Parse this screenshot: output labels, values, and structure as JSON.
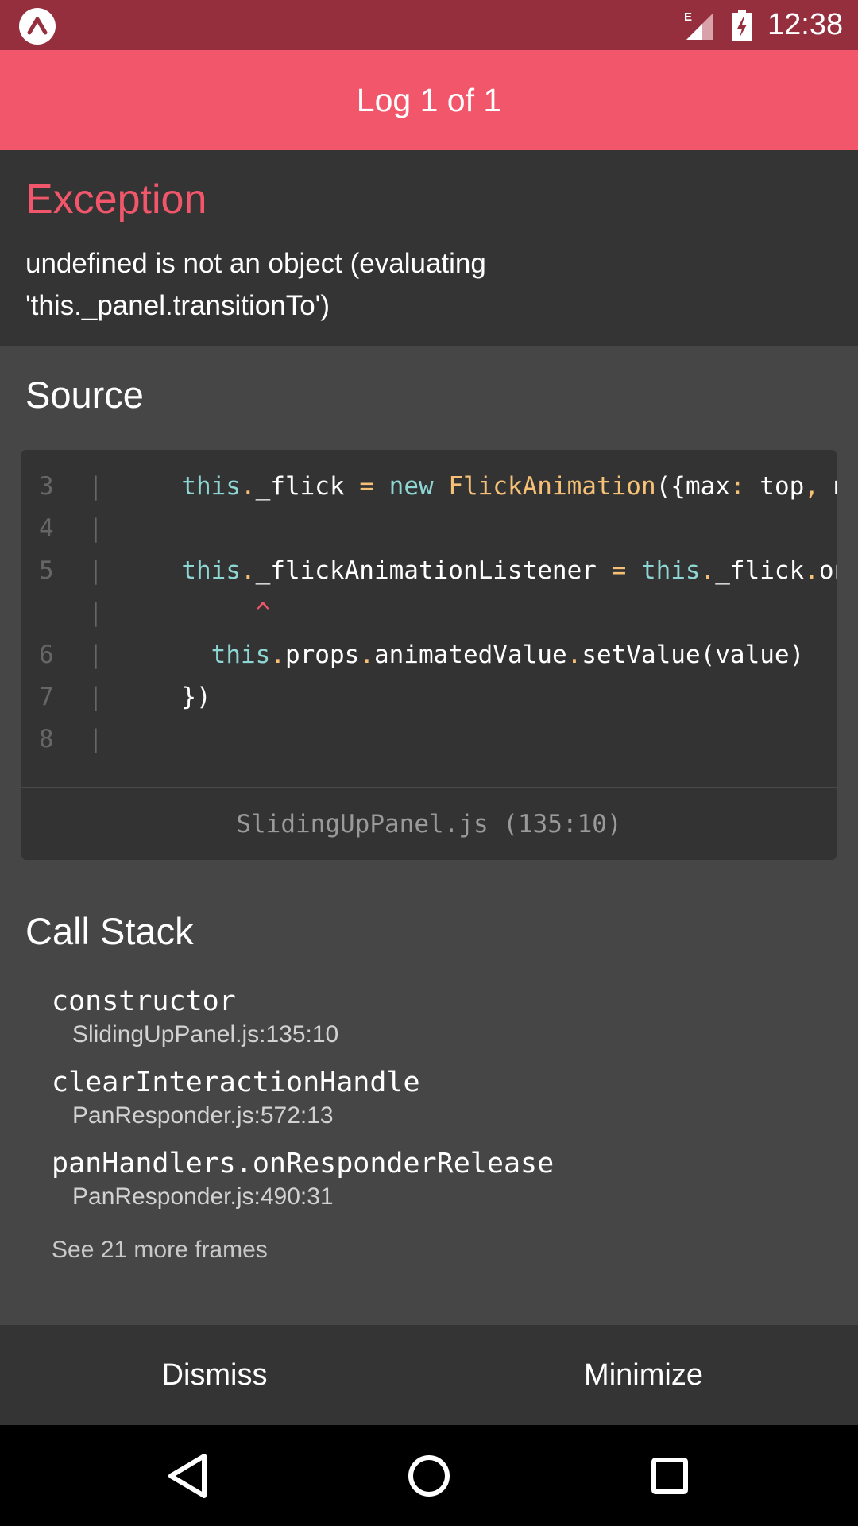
{
  "status_bar": {
    "time": "12:38",
    "network_type": "E",
    "icons": [
      "expo-logo-icon",
      "signal-icon",
      "battery-charging-icon"
    ]
  },
  "header": {
    "title": "Log 1 of 1"
  },
  "exception": {
    "title": "Exception",
    "message_line1": "undefined is not an object (evaluating",
    "message_line2": "'this._panel.transitionTo')"
  },
  "source": {
    "title": "Source",
    "lines": [
      {
        "num": "3",
        "code": "    this._flick = new FlickAnimation({max: top, min: bottom})"
      },
      {
        "num": "4",
        "code": ""
      },
      {
        "num": "5",
        "code": "    this._flickAnimationListener = this._flick.onUpdate"
      },
      {
        "num": "",
        "code": "          ^"
      },
      {
        "num": "6",
        "code": "      this.props.animatedValue.setValue(value)"
      },
      {
        "num": "7",
        "code": "    })"
      },
      {
        "num": "8",
        "code": ""
      }
    ],
    "file_location": "SlidingUpPanel.js (135:10)"
  },
  "call_stack": {
    "title": "Call Stack",
    "frames": [
      {
        "function": "constructor",
        "location": "SlidingUpPanel.js:135:10"
      },
      {
        "function": "clearInteractionHandle",
        "location": "PanResponder.js:572:13"
      },
      {
        "function": "panHandlers.onResponderRelease",
        "location": "PanResponder.js:490:31"
      }
    ],
    "more_frames": "See 21 more frames"
  },
  "actions": {
    "dismiss_label": "Dismiss",
    "minimize_label": "Minimize"
  },
  "colors": {
    "status_bar": "#952f3e",
    "header": "#f1566a",
    "accent": "#f1566a",
    "panel_dark": "#343434",
    "panel_mid": "#464646",
    "code_bg": "#333333"
  }
}
